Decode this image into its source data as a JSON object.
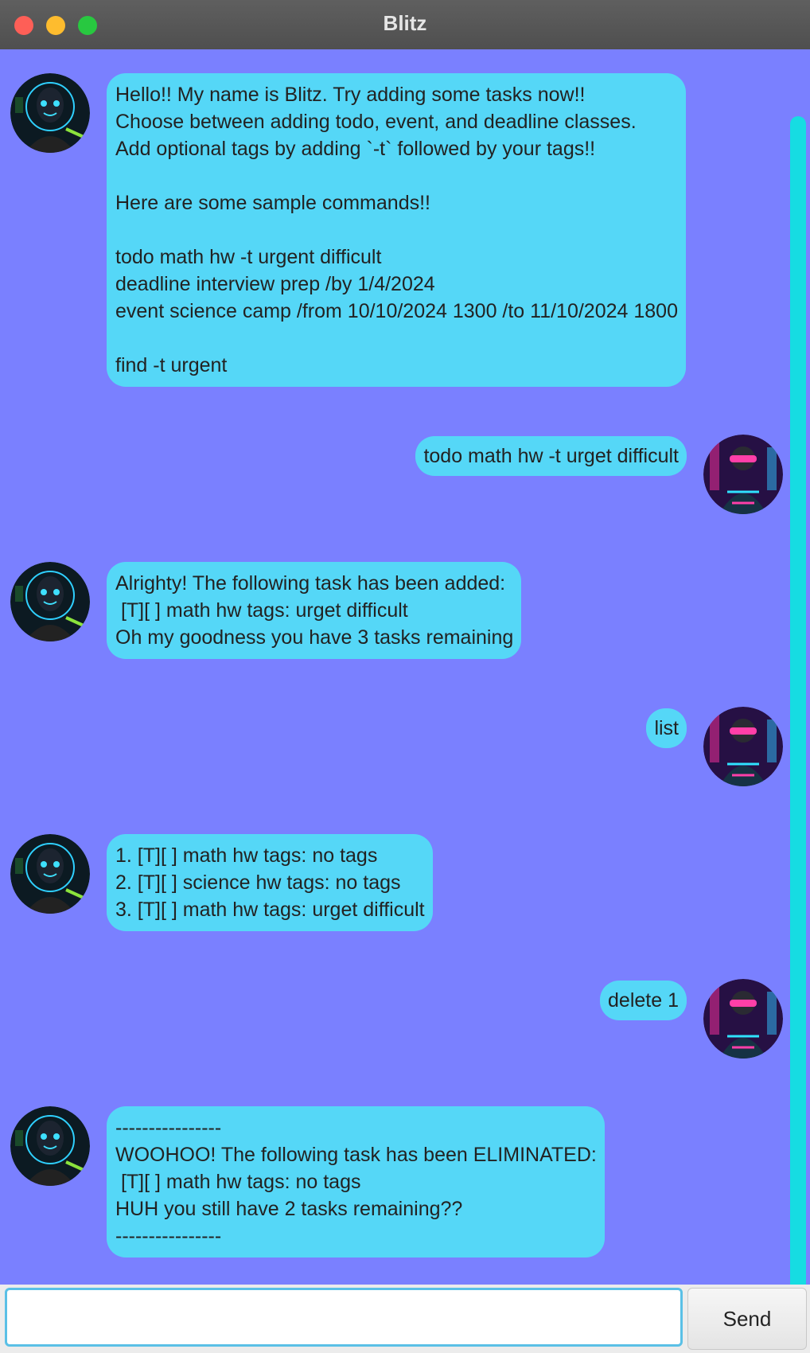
{
  "window": {
    "title": "Blitz"
  },
  "messages": [
    {
      "sender": "bot",
      "text": "Hello!! My name is Blitz. Try adding some tasks now!!\nChoose between adding todo, event, and deadline classes.\nAdd optional tags by adding `-t` followed by your tags!!\n\nHere are some sample commands!!\n\ntodo math hw -t urgent difficult\ndeadline interview prep /by 1/4/2024\nevent science camp /from 10/10/2024 1300 /to 11/10/2024 1800\n\nfind -t urgent"
    },
    {
      "sender": "user",
      "text": "todo math hw -t urget difficult"
    },
    {
      "sender": "bot",
      "text": "Alrighty! The following task has been added:\n [T][ ] math hw tags: urget difficult\nOh my goodness you have 3 tasks remaining"
    },
    {
      "sender": "user",
      "text": "list"
    },
    {
      "sender": "bot",
      "text": "1. [T][ ] math hw tags: no tags\n2. [T][ ] science hw tags: no tags\n3. [T][ ] math hw tags: urget difficult"
    },
    {
      "sender": "user",
      "text": "delete 1"
    },
    {
      "sender": "bot",
      "text": "----------------\nWOOHOO! The following task has been ELIMINATED:\n [T][ ] math hw tags: no tags\nHUH you still have 2 tasks remaining??\n----------------"
    }
  ],
  "input": {
    "value": "",
    "send_label": "Send"
  },
  "colors": {
    "background": "#7a80ff",
    "bubble": "#55d7f7",
    "scrollbar": "#16dce2",
    "input_border": "#5ac0e6"
  },
  "icons": {
    "bot_avatar": "robot-avatar-icon",
    "user_avatar": "cyberpunk-user-avatar-icon"
  }
}
